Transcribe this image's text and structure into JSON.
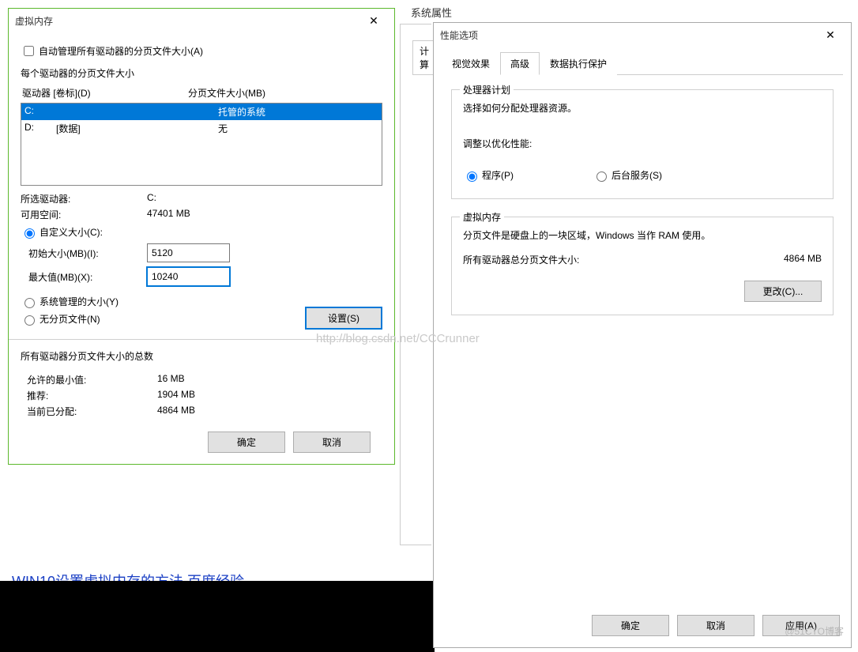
{
  "background": {
    "sysprops_title": "系统属性",
    "tab_hint": "计算",
    "blue_link": "WIN10设置虚拟内存的方法  百度经验",
    "watermark": "http://blog.csdn.net/CCCrunner",
    "blog_wm": "@51CTO博客"
  },
  "vm_dialog": {
    "title": "虚拟内存",
    "auto_manage": "自动管理所有驱动器的分页文件大小(A)",
    "per_drive_label": "每个驱动器的分页文件大小",
    "cols": {
      "drive": "驱动器 [卷标](D)",
      "size": "分页文件大小(MB)"
    },
    "drives": [
      {
        "letter": "C:",
        "label": "",
        "size": "托管的系统"
      },
      {
        "letter": "D:",
        "label": "[数据]",
        "size": "无"
      }
    ],
    "selected_drive_label": "所选驱动器:",
    "selected_drive_value": "C:",
    "free_space_label": "可用空间:",
    "free_space_value": "47401 MB",
    "custom_size": "自定义大小(C):",
    "initial_label": "初始大小(MB)(I):",
    "initial_value": "5120",
    "max_label": "最大值(MB)(X):",
    "max_value": "10240",
    "system_managed": "系统管理的大小(Y)",
    "no_paging": "无分页文件(N)",
    "set_btn": "设置(S)",
    "totals_label": "所有驱动器分页文件大小的总数",
    "min_label": "允许的最小值:",
    "min_value": "16 MB",
    "rec_label": "推荐:",
    "rec_value": "1904 MB",
    "alloc_label": "当前已分配:",
    "alloc_value": "4864 MB",
    "ok": "确定",
    "cancel": "取消"
  },
  "perf_dialog": {
    "title": "性能选项",
    "tabs": {
      "visual": "视觉效果",
      "advanced": "高级",
      "dep": "数据执行保护"
    },
    "proc": {
      "legend": "处理器计划",
      "desc": "选择如何分配处理器资源。",
      "adjust": "调整以优化性能:",
      "programs": "程序(P)",
      "background": "后台服务(S)"
    },
    "vmem": {
      "legend": "虚拟内存",
      "desc": "分页文件是硬盘上的一块区域，Windows 当作 RAM 使用。",
      "total_label": "所有驱动器总分页文件大小:",
      "total_value": "4864 MB",
      "change": "更改(C)..."
    },
    "ok": "确定",
    "cancel": "取消",
    "apply": "应用(A)"
  }
}
